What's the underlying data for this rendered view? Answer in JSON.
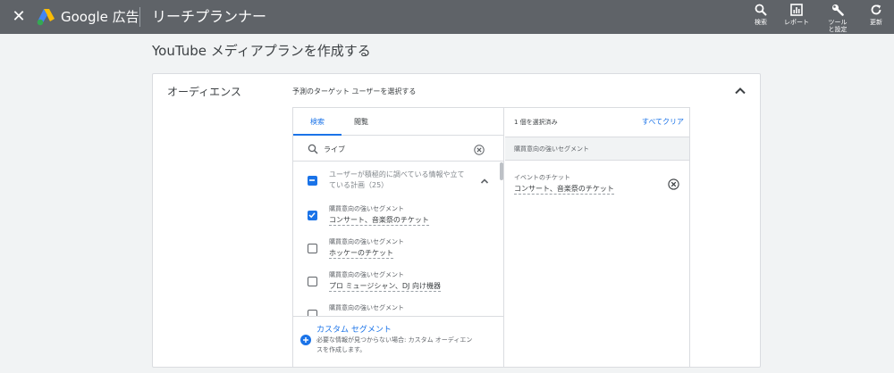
{
  "topbar": {
    "brand": "Google 広告",
    "tool_title": "リーチプランナー",
    "actions": [
      {
        "label": "検索",
        "icon": "search-icon"
      },
      {
        "label": "レポート",
        "icon": "report-icon"
      },
      {
        "label": "ツールと設定",
        "icon": "wrench-icon"
      },
      {
        "label": "更新",
        "icon": "refresh-icon"
      }
    ]
  },
  "page": {
    "title": "YouTube メディアプランを作成する"
  },
  "audience": {
    "section_label": "オーディエンス",
    "prompt": "予測のターゲット ユーザーを選択する",
    "tabs": [
      {
        "label": "検索",
        "active": true
      },
      {
        "label": "閲覧",
        "active": false
      }
    ],
    "search": {
      "value": "ライブ",
      "placeholder": ""
    },
    "group": {
      "text": "ユーザーが積極的に調べている情報や立てている計画（25）",
      "state": "indeterminate"
    },
    "items": [
      {
        "category": "購買意向の強いセグメント",
        "name": "コンサート、音楽祭のチケット",
        "checked": true
      },
      {
        "category": "購買意向の強いセグメント",
        "name": "ホッケーのチケット",
        "checked": false
      },
      {
        "category": "購買意向の強いセグメント",
        "name": "プロ ミュージシャン、DJ 向け機器",
        "checked": false
      },
      {
        "category": "購買意向の強いセグメント",
        "name": "",
        "checked": false
      }
    ],
    "custom_segment": {
      "link": "カスタム セグメント",
      "description": "必要な情報が見つからない場合: カスタム オーディエンスを作成します。"
    },
    "selected": {
      "count_label": "1 個を選択済み",
      "clear_all": "すべてクリア",
      "group_label": "購買意向の強いセグメント",
      "items": [
        {
          "category": "イベントのチケット",
          "name": "コンサート、音楽祭のチケット"
        }
      ]
    }
  },
  "colors": {
    "topbar": "#5f6368",
    "accent": "#1a73e8",
    "background": "#f1f3f4"
  }
}
